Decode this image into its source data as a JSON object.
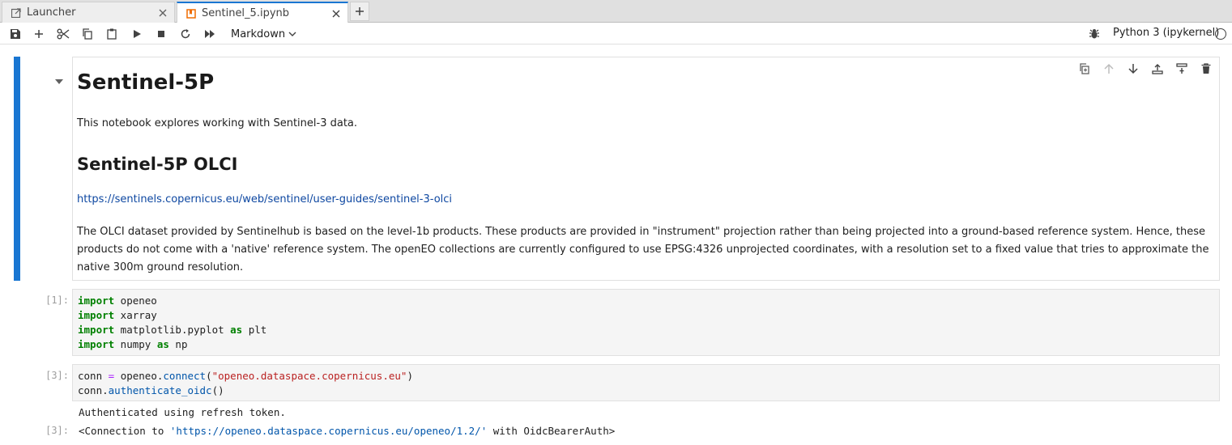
{
  "tabs": [
    {
      "label": "Launcher",
      "icon": "launcher-icon",
      "active": false
    },
    {
      "label": "Sentinel_5.ipynb",
      "icon": "notebook-icon",
      "active": true
    }
  ],
  "toolbar": {
    "buttons": [
      "save-icon",
      "add-cell-icon",
      "cut-icon",
      "copy-icon",
      "paste-icon",
      "run-icon",
      "stop-icon",
      "restart-icon",
      "run-all-icon"
    ],
    "cell_type": "Markdown",
    "kernel_name": "Python 3 (ipykernel)"
  },
  "markdown_cell": {
    "h1": "Sentinel-5P",
    "intro": "This notebook explores working with Sentinel-3 data.",
    "h2": "Sentinel-5P OLCI",
    "link": "https://sentinels.copernicus.eu/web/sentinel/user-guides/sentinel-3-olci",
    "paragraph": "The OLCI dataset provided by Sentinelhub is based on the level-1b products. These products are provided in \"instrument\" projection rather than being projected into a ground-based reference system. Hence, these products do not come with a 'native' reference system. The openEO collections are currently configured to use EPSG:4326 unprojected coordinates, with a resolution set to a fixed value that tries to approximate the native 300m ground resolution."
  },
  "code_cell_1": {
    "prompt": "[1]:",
    "lines": [
      {
        "kw": "import",
        "rest": " openeo"
      },
      {
        "kw": "import",
        "rest": " xarray"
      },
      {
        "kw": "import",
        "rest": " matplotlib.pyplot ",
        "kw2": "as",
        "rest2": " plt"
      },
      {
        "kw": "import",
        "rest": " numpy ",
        "kw2": "as",
        "rest2": " np"
      }
    ]
  },
  "code_cell_2": {
    "prompt": "[3]:",
    "line1": {
      "var": "conn ",
      "op": "=",
      "obj": " openeo.",
      "fn": "connect",
      "open": "(",
      "str": "\"openeo.dataspace.copernicus.eu\"",
      "close": ")"
    },
    "line2": {
      "obj": "conn.",
      "fn": "authenticate_oidc",
      "parens": "()"
    }
  },
  "output": {
    "stderr": "Authenticated using refresh token.",
    "prompt": "[3]:",
    "result_prefix": "<Connection to ",
    "result_url": "'https://openeo.dataspace.copernicus.eu/openeo/1.2/'",
    "result_suffix": " with OidcBearerAuth>"
  }
}
